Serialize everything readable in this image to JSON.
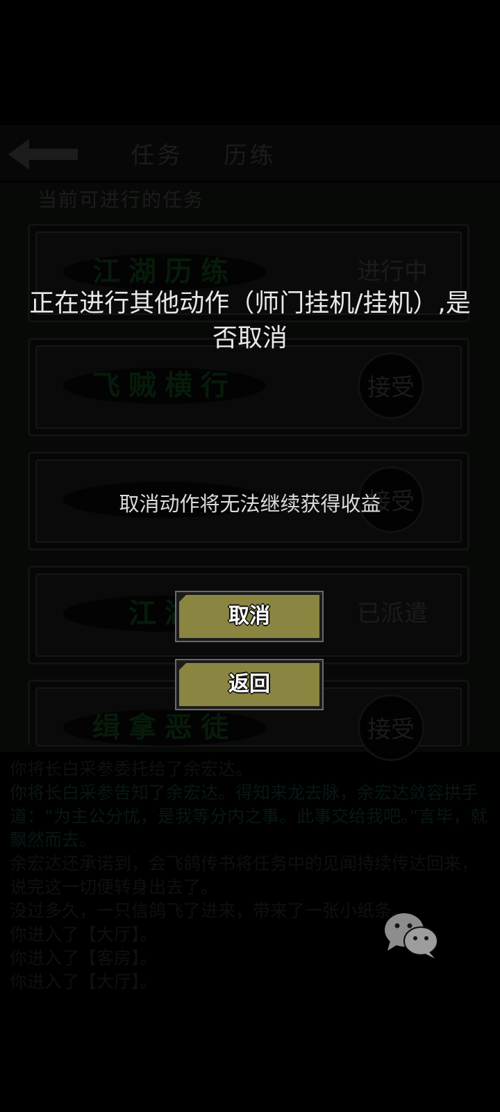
{
  "header": {
    "tabs": [
      {
        "label": "任务"
      },
      {
        "label": "历练"
      }
    ]
  },
  "section_title": "当前可进行的任务",
  "quests": [
    {
      "name": "江湖历练",
      "status": "进行中"
    },
    {
      "name": "飞贼横行",
      "status": "接受"
    },
    {
      "name": "",
      "status": "接受"
    },
    {
      "name": "江湖",
      "status": "已派遣"
    },
    {
      "name": "缉拿恶徒",
      "status": "接受"
    }
  ],
  "log": [
    "你将长白采参委托给了余宏达。",
    "你将长白采参告知了余宏达。得知来龙去脉，余宏达敛容拱手道：“为主公分忧，是我等分内之事。此事交给我吧。”言毕，就飘然而去。",
    "余宏达还承诺到，会飞鸽传书将任务中的见闻持续传达回来，说完这一切便转身出去了。",
    "没过多久，一只信鸽飞了进来，带来了一张小纸条。",
    "你进入了【大厅】。",
    "你进入了【客房】。",
    "你进入了【大厅】。"
  ],
  "dialog": {
    "title": "正在进行其他动作（师门挂机/挂机）,是否取消",
    "message": "取消动作将无法继续获得收益",
    "buttons": {
      "cancel": "取消",
      "back": "返回"
    }
  },
  "icons": {
    "back": "back-arrow-icon",
    "floating": "wechat-icon"
  },
  "colors": {
    "button_face": "#8a8642",
    "dialog_text": "#e8e8e8"
  }
}
